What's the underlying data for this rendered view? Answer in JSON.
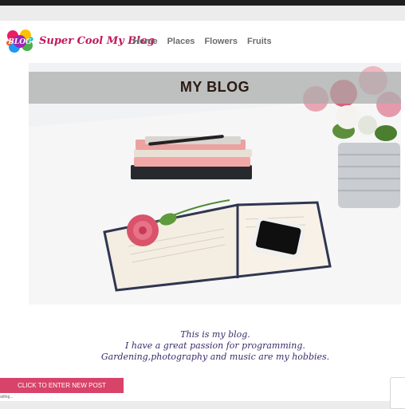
{
  "brand": {
    "logo_text": "BLOG",
    "name": "Super Cool My Blog"
  },
  "nav": {
    "items": [
      "Home",
      "Places",
      "Flowers",
      "Fruits"
    ]
  },
  "hero": {
    "title": "MY BLOG"
  },
  "tagline": {
    "lines": [
      "This is my blog.",
      "I have a great passion for programming.",
      "Gardening,photography and music are my hobbies."
    ]
  },
  "cta": {
    "label": "CLICK TO ENTER NEW POST"
  },
  "status": {
    "loading": "ading..."
  },
  "colors": {
    "brand": "#c2185b",
    "cta": "#d8436a",
    "tagline": "#3b2a6b"
  }
}
